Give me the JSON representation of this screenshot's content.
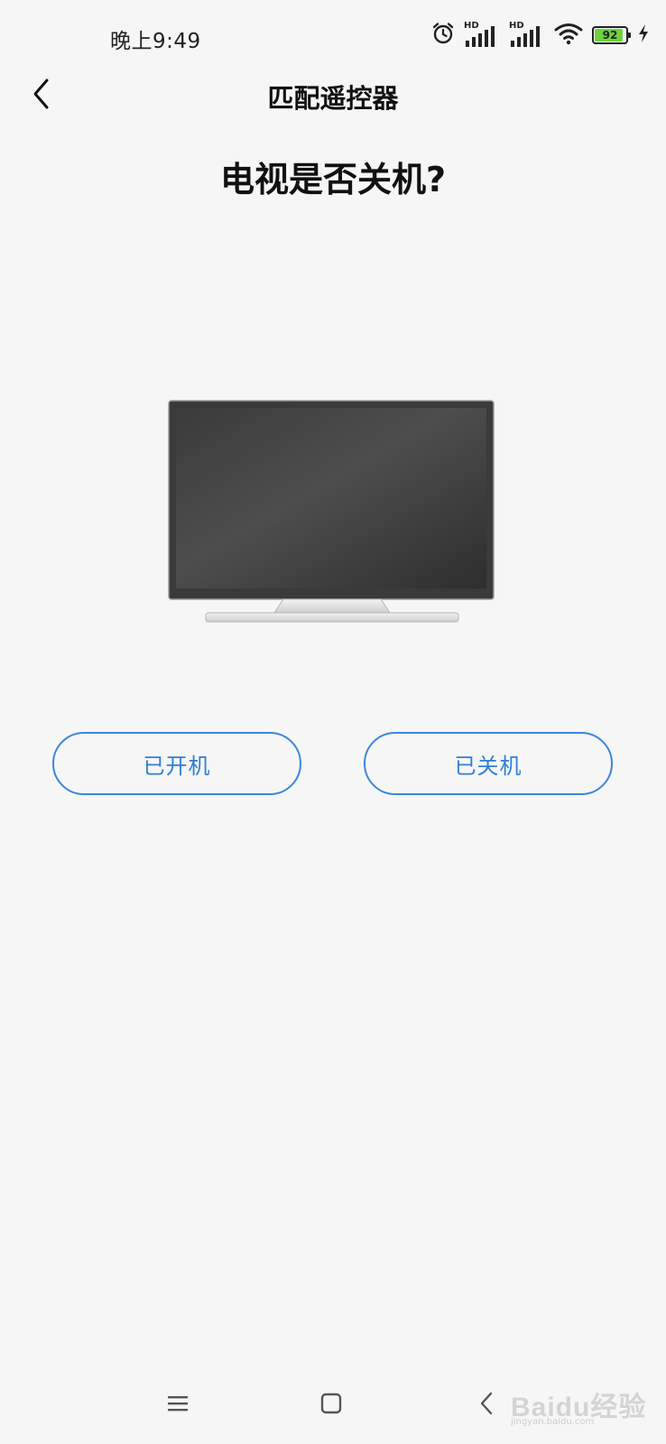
{
  "status_bar": {
    "time": "晚上9:49",
    "network_badge_1": "HD",
    "network_badge_2": "HD",
    "battery_level": "92",
    "battery_fraction": 0.92,
    "icons": [
      "alarm-icon",
      "signal-icon",
      "signal-icon",
      "wifi-icon",
      "battery-icon",
      "charging-icon"
    ]
  },
  "header": {
    "title": "匹配遥控器",
    "back_icon": "chevron-left-icon"
  },
  "main": {
    "question": "电视是否关机?",
    "illustration": "tv-icon",
    "buttons": {
      "on_label": "已开机",
      "off_label": "已关机"
    }
  },
  "nav_bar": {
    "icons": [
      "menu-icon",
      "home-icon",
      "back-icon"
    ]
  },
  "watermark": {
    "text": "Baidu经验",
    "sub": "jingyan.baidu.com"
  },
  "colors": {
    "background": "#f6f6f6",
    "accent": "#3b87d9",
    "battery": "#6bd43c"
  }
}
